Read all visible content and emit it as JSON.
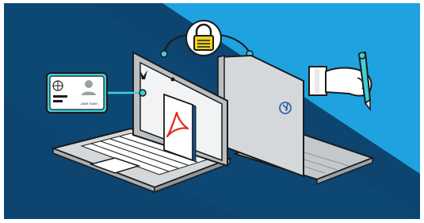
{
  "illustration": {
    "id_card": {
      "caption": "JANE SIAM"
    },
    "colors": {
      "dark_navy": "#0d4570",
      "sky_blue": "#1fa3e0",
      "accent_cyan": "#3fd0d8",
      "lock_yellow": "#f2d21a",
      "laptop_gray": "#d4d8da",
      "outline": "#1b1b1b",
      "pdf_red": "#e02b20"
    },
    "icons": [
      "id-card-icon",
      "padlock-icon",
      "pdf-icon",
      "fountain-pen-icon",
      "hand-icon",
      "key-emblem-icon"
    ]
  }
}
